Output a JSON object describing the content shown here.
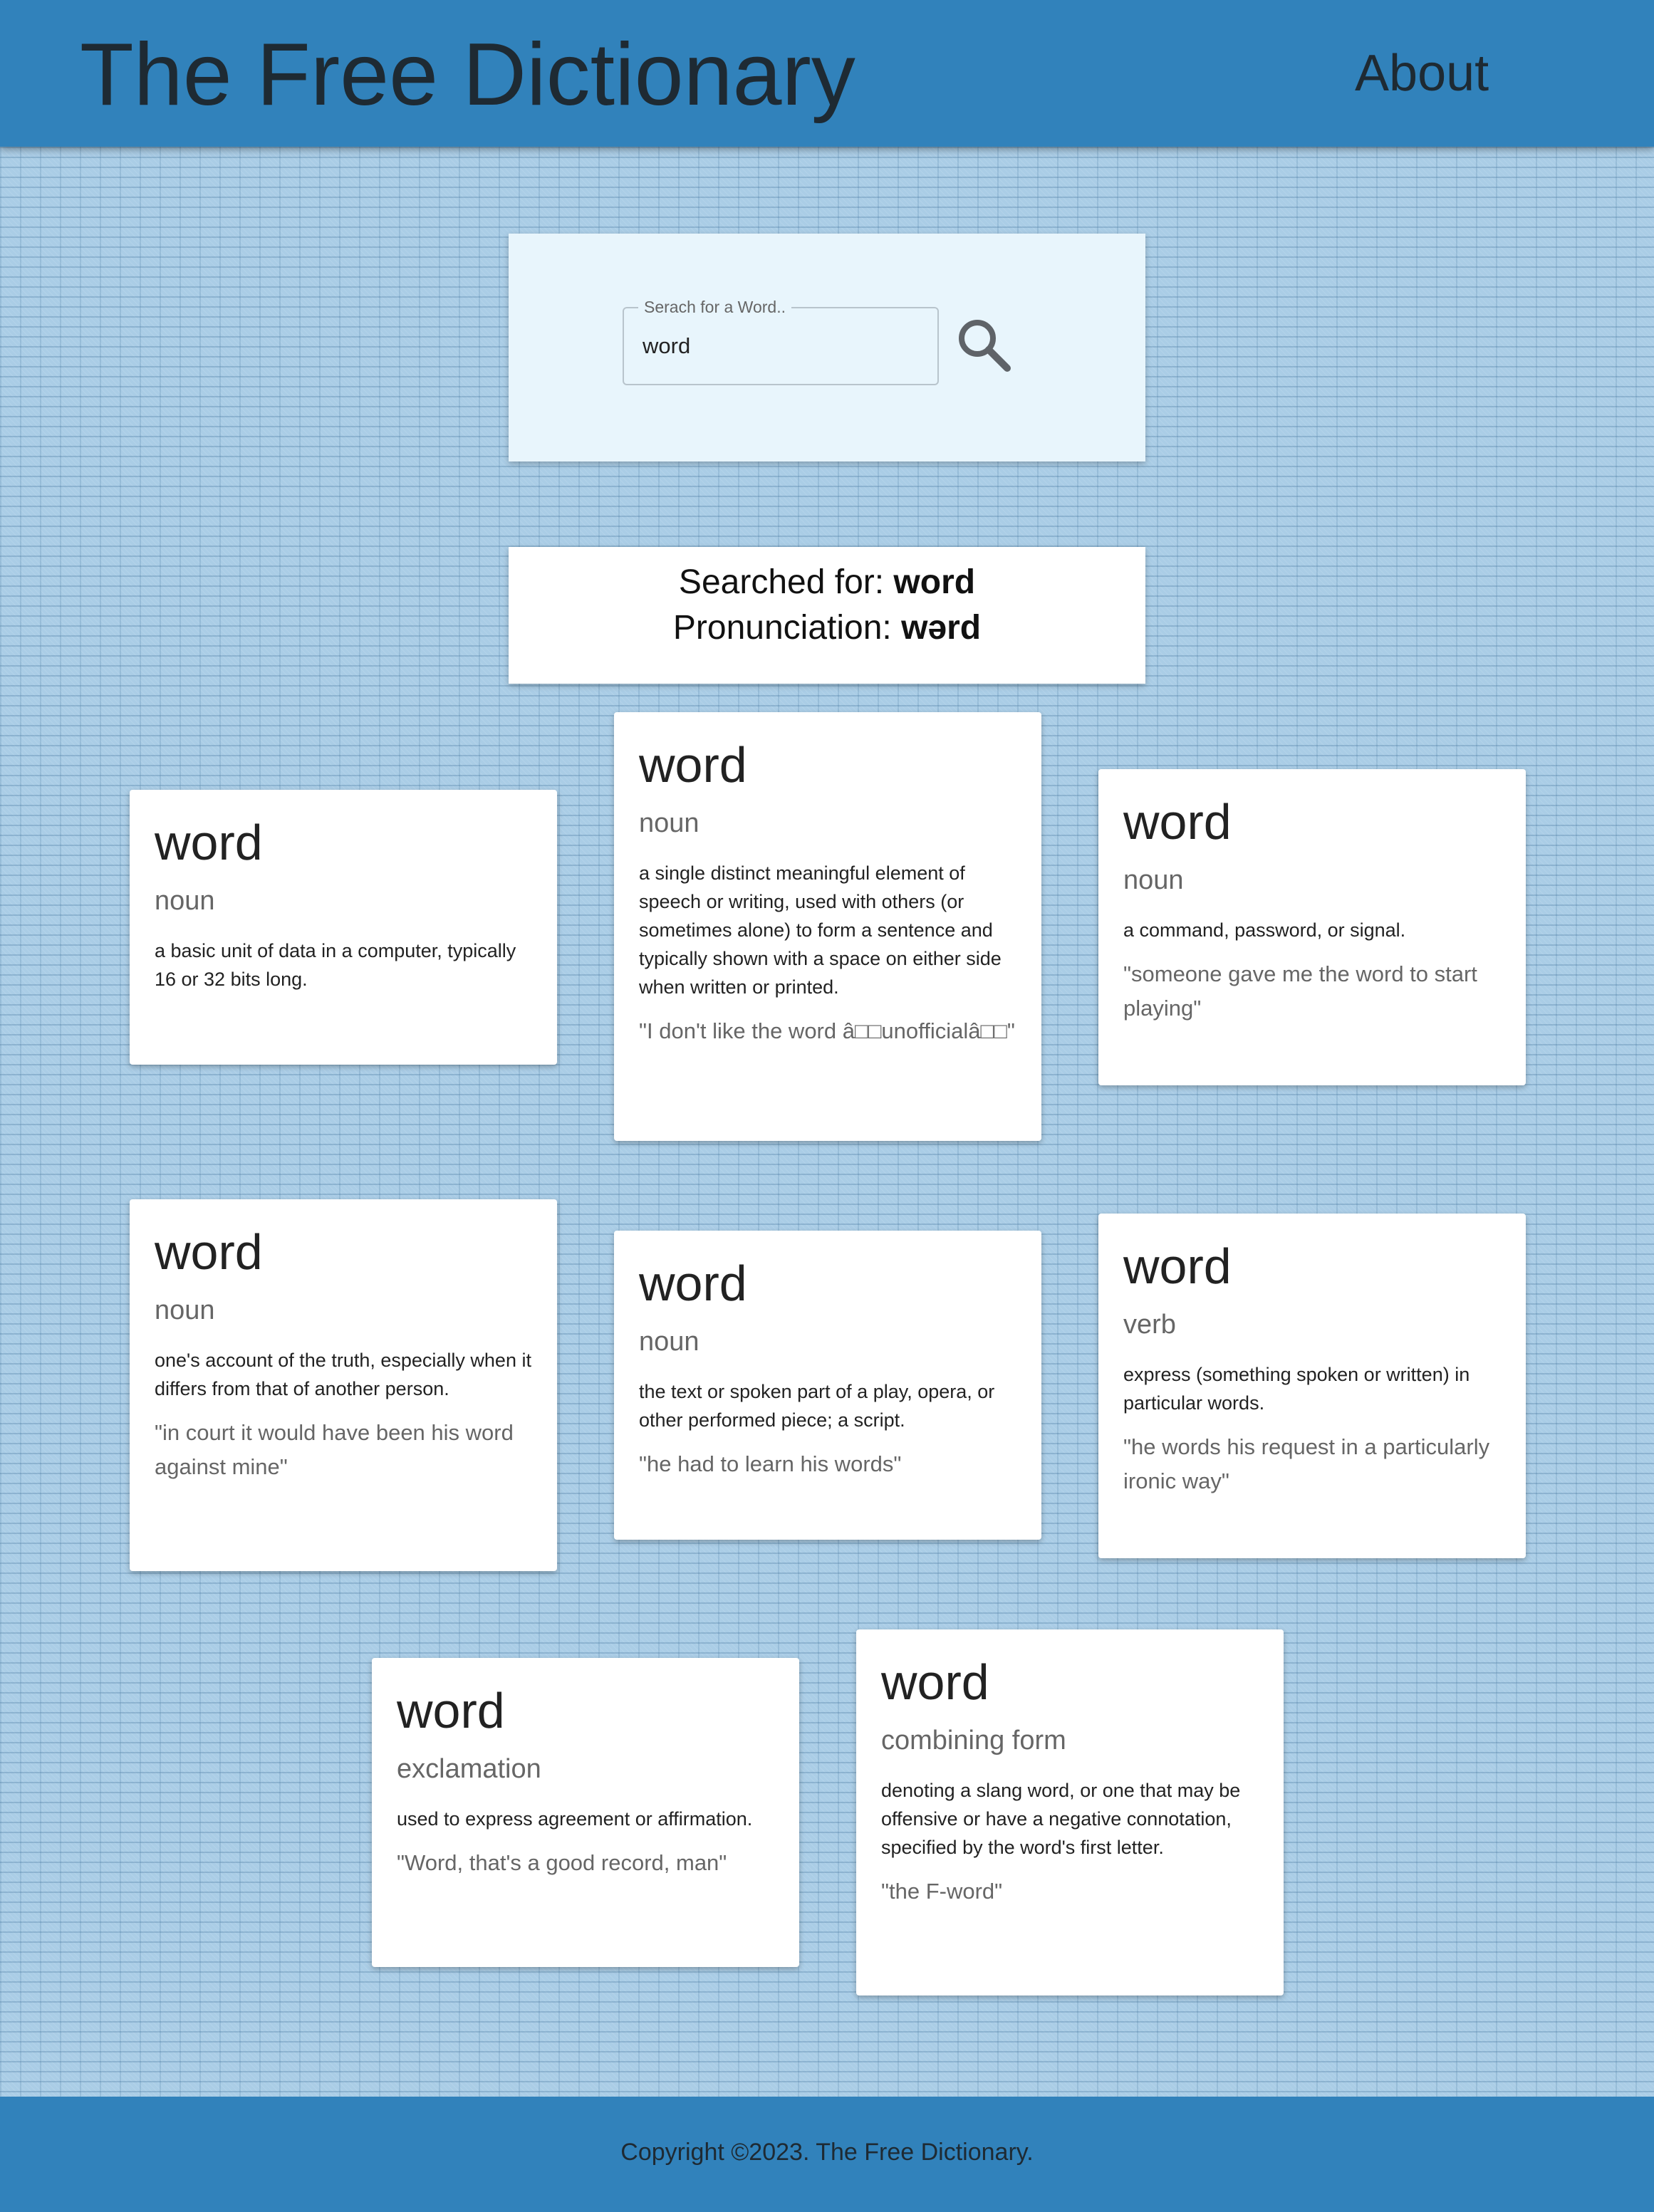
{
  "header": {
    "title": "The Free Dictionary",
    "about_label": "About"
  },
  "search": {
    "legend": "Serach for a Word..",
    "value": "word",
    "button_icon": "search-icon"
  },
  "result": {
    "searched_label": "Searched for: ",
    "searched_value": "word",
    "pronunciation_label": "Pronunciation: ",
    "pronunciation_value": "wərd"
  },
  "cards": [
    {
      "word": "word",
      "pos": "noun",
      "definition": "a basic unit of data in a computer, typically 16 or 32 bits long.",
      "example": ""
    },
    {
      "word": "word",
      "pos": "noun",
      "definition": "a single distinct meaningful element of speech or writing, used with others (or sometimes alone) to form a sentence and typically shown with a space on either side when written or printed.",
      "example": "\"I don't like the word â□□unofficialâ□□\""
    },
    {
      "word": "word",
      "pos": "noun",
      "definition": "a command, password, or signal.",
      "example": "\"someone gave me the word to start playing\""
    },
    {
      "word": "word",
      "pos": "noun",
      "definition": "one's account of the truth, especially when it differs from that of another person.",
      "example": "\"in court it would have been his word against mine\""
    },
    {
      "word": "word",
      "pos": "noun",
      "definition": "the text or spoken part of a play, opera, or other performed piece; a script.",
      "example": "\"he had to learn his words\""
    },
    {
      "word": "word",
      "pos": "verb",
      "definition": "express (something spoken or written) in particular words.",
      "example": "\"he words his request in a particularly ironic way\""
    },
    {
      "word": "word",
      "pos": "exclamation",
      "definition": "used to express agreement or affirmation.",
      "example": "\"Word, that's a good record, man\""
    },
    {
      "word": "word",
      "pos": "combining form",
      "definition": "denoting a slang word, or one that may be offensive or have a negative connotation, specified by the word's first letter.",
      "example": "\"the F-word\""
    }
  ],
  "footer": {
    "copyright": "Copyright ©2023. The Free Dictionary."
  }
}
